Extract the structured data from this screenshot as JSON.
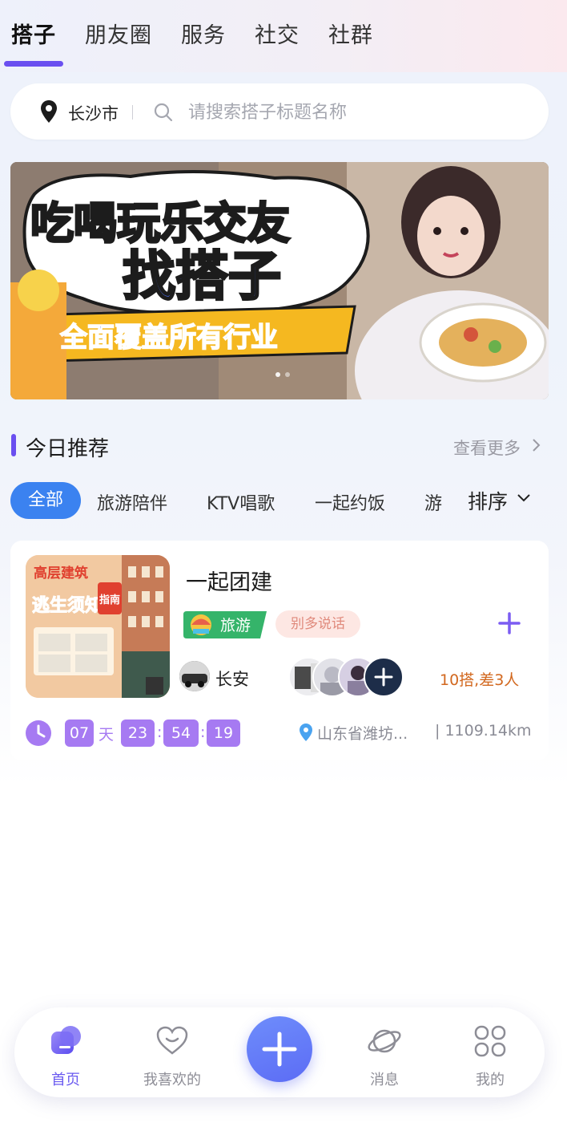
{
  "tabs": [
    {
      "label": "搭子",
      "active": true
    },
    {
      "label": "朋友圈",
      "active": false
    },
    {
      "label": "服务",
      "active": false
    },
    {
      "label": "社交",
      "active": false
    },
    {
      "label": "社群",
      "active": false
    }
  ],
  "search": {
    "city": "长沙市",
    "placeholder": "请搜索搭子标题名称",
    "value": ""
  },
  "banner": {
    "line1": "吃喝玩乐交友",
    "line2": "找搭子",
    "line3": "全面覆盖所有行业"
  },
  "section": {
    "title": "今日推荐",
    "see_more": "查看更多"
  },
  "categories": {
    "selected": "全部",
    "items": [
      "旅游陪伴",
      "KTV唱歌",
      "一起约饭",
      "游"
    ],
    "sort_label": "排序"
  },
  "card": {
    "thumb_text": {
      "top": "高层建筑",
      "middle": "逃生须知",
      "badge": "指南"
    },
    "title": "一起团建",
    "tag_category": "旅游",
    "tag_note": "别多说话",
    "user_name": "长安",
    "count_text": "10搭,差3人",
    "countdown": {
      "days": "07",
      "days_label": "天",
      "hours": "23",
      "minutes": "54",
      "seconds": "19",
      "sep": ":"
    },
    "location": "山东省潍坊...",
    "distance": "| 1109.14km"
  },
  "bottom_nav": {
    "items": [
      {
        "label": "首页",
        "icon": "home-icon",
        "active": true
      },
      {
        "label": "我喜欢的",
        "icon": "heart-icon",
        "active": false
      },
      {
        "label": "消息",
        "icon": "planet-icon",
        "active": false
      },
      {
        "label": "我的",
        "icon": "grid-icon",
        "active": false
      }
    ],
    "center_icon": "plus-icon"
  },
  "colors": {
    "accent": "#6a4ff0",
    "chip_active": "#3b82f0",
    "countdown": "#a67af2",
    "count_text": "#d2681f",
    "tag_green": "#35b46a"
  }
}
